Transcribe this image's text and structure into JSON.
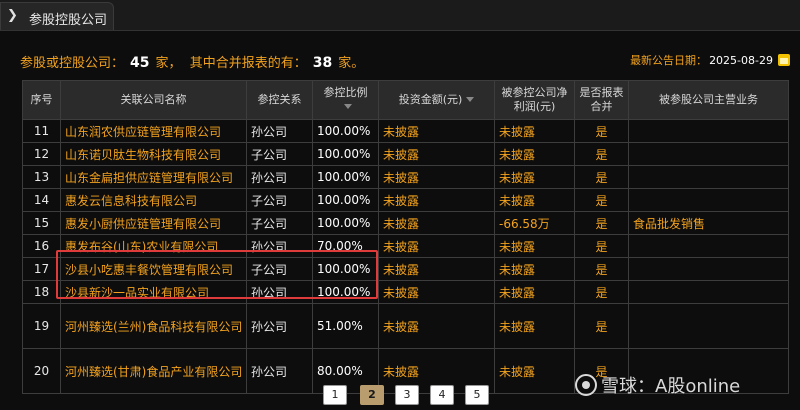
{
  "titlebar": {
    "tab_title": "参股控股公司",
    "arrow": "❯"
  },
  "summary": {
    "prefix": "参股或控股公司：",
    "count": "45",
    "unit1": "家，",
    "middle": "其中合并报表的有：",
    "merged": "38",
    "unit2": "家。"
  },
  "latest": {
    "label": "最新公告日期：",
    "date": "2025-08-29"
  },
  "columns": [
    "序号",
    "关联公司名称",
    "参控关系",
    "参控比例",
    "投资金额(元)",
    "被参控公司净利润(元)",
    "是否报表合并",
    "被参股公司主营业务"
  ],
  "rows": [
    {
      "seq": "11",
      "name": "山东润农供应链管理有限公司",
      "relation": "孙公司",
      "ratio": "100.00%",
      "investment": "未披露",
      "profit": "未披露",
      "consolidated": "是",
      "business": ""
    },
    {
      "seq": "12",
      "name": "山东诺贝肽生物科技有限公司",
      "relation": "子公司",
      "ratio": "100.00%",
      "investment": "未披露",
      "profit": "未披露",
      "consolidated": "是",
      "business": ""
    },
    {
      "seq": "13",
      "name": "山东金扁担供应链管理有限公司",
      "relation": "孙公司",
      "ratio": "100.00%",
      "investment": "未披露",
      "profit": "未披露",
      "consolidated": "是",
      "business": ""
    },
    {
      "seq": "14",
      "name": "惠发云信息科技有限公司",
      "relation": "子公司",
      "ratio": "100.00%",
      "investment": "未披露",
      "profit": "未披露",
      "consolidated": "是",
      "business": ""
    },
    {
      "seq": "15",
      "name": "惠发小厨供应链管理有限公司",
      "relation": "子公司",
      "ratio": "100.00%",
      "investment": "未披露",
      "profit": "-66.58万",
      "consolidated": "是",
      "business": "食品批发销售"
    },
    {
      "seq": "16",
      "name": "惠发布谷(山东)农业有限公司",
      "relation": "孙公司",
      "ratio": "70.00%",
      "investment": "未披露",
      "profit": "未披露",
      "consolidated": "是",
      "business": ""
    },
    {
      "seq": "17",
      "name": "沙县小吃惠丰餐饮管理有限公司",
      "relation": "子公司",
      "ratio": "100.00%",
      "investment": "未披露",
      "profit": "未披露",
      "consolidated": "是",
      "business": ""
    },
    {
      "seq": "18",
      "name": "沙县新沙一品实业有限公司",
      "relation": "孙公司",
      "ratio": "100.00%",
      "investment": "未披露",
      "profit": "未披露",
      "consolidated": "是",
      "business": ""
    },
    {
      "seq": "19",
      "name": "河州臻选(兰州)食品科技有限公司",
      "relation": "孙公司",
      "ratio": "51.00%",
      "investment": "未披露",
      "profit": "未披露",
      "consolidated": "是",
      "business": ""
    },
    {
      "seq": "20",
      "name": "河州臻选(甘肃)食品产业有限公司",
      "relation": "孙公司",
      "ratio": "80.00%",
      "investment": "未披露",
      "profit": "未披露",
      "consolidated": "是",
      "business": ""
    }
  ],
  "pagination": {
    "pages": [
      "1",
      "2",
      "3",
      "4",
      "5"
    ],
    "current": "2"
  },
  "watermark": {
    "text": "雪球：A股online"
  },
  "colors": {
    "accent": "#f2a21f",
    "highlight": "#e03b3b",
    "active_page": "#b99d6e"
  }
}
